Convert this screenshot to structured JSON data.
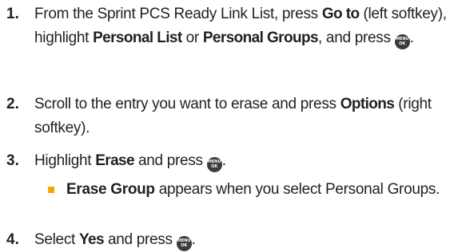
{
  "steps": [
    {
      "number": "1.",
      "t1": "From the Sprint PCS Ready Link List, press ",
      "b1": "Go to",
      "t2": " (left softkey), highlight ",
      "b2": "Personal List",
      "t3": " or ",
      "b3": "Personal Groups",
      "t4": ", and press ",
      "icon": "menu-ok-icon",
      "t5": "."
    },
    {
      "number": "2.",
      "t1": "Scroll to the entry you want to erase and press ",
      "b1": "Options",
      "t2": " (right softkey)."
    },
    {
      "number": "3.",
      "t1": "Highlight ",
      "b1": "Erase",
      "t2": " and press ",
      "icon": "menu-ok-icon",
      "t3": ".",
      "bullet": {
        "b1": "Erase Group",
        "t1": " appears when you select Personal Groups."
      }
    },
    {
      "number": "4.",
      "t1": "Select ",
      "b1": "Yes",
      "t2": " and press ",
      "icon": "menu-ok-icon",
      "t3": "."
    }
  ],
  "icon_text": {
    "top": "MENU",
    "bottom": "OK"
  },
  "colors": {
    "text": "#231f20",
    "bullet": "#f2a900",
    "icon_bg": "#3b3b3b"
  }
}
